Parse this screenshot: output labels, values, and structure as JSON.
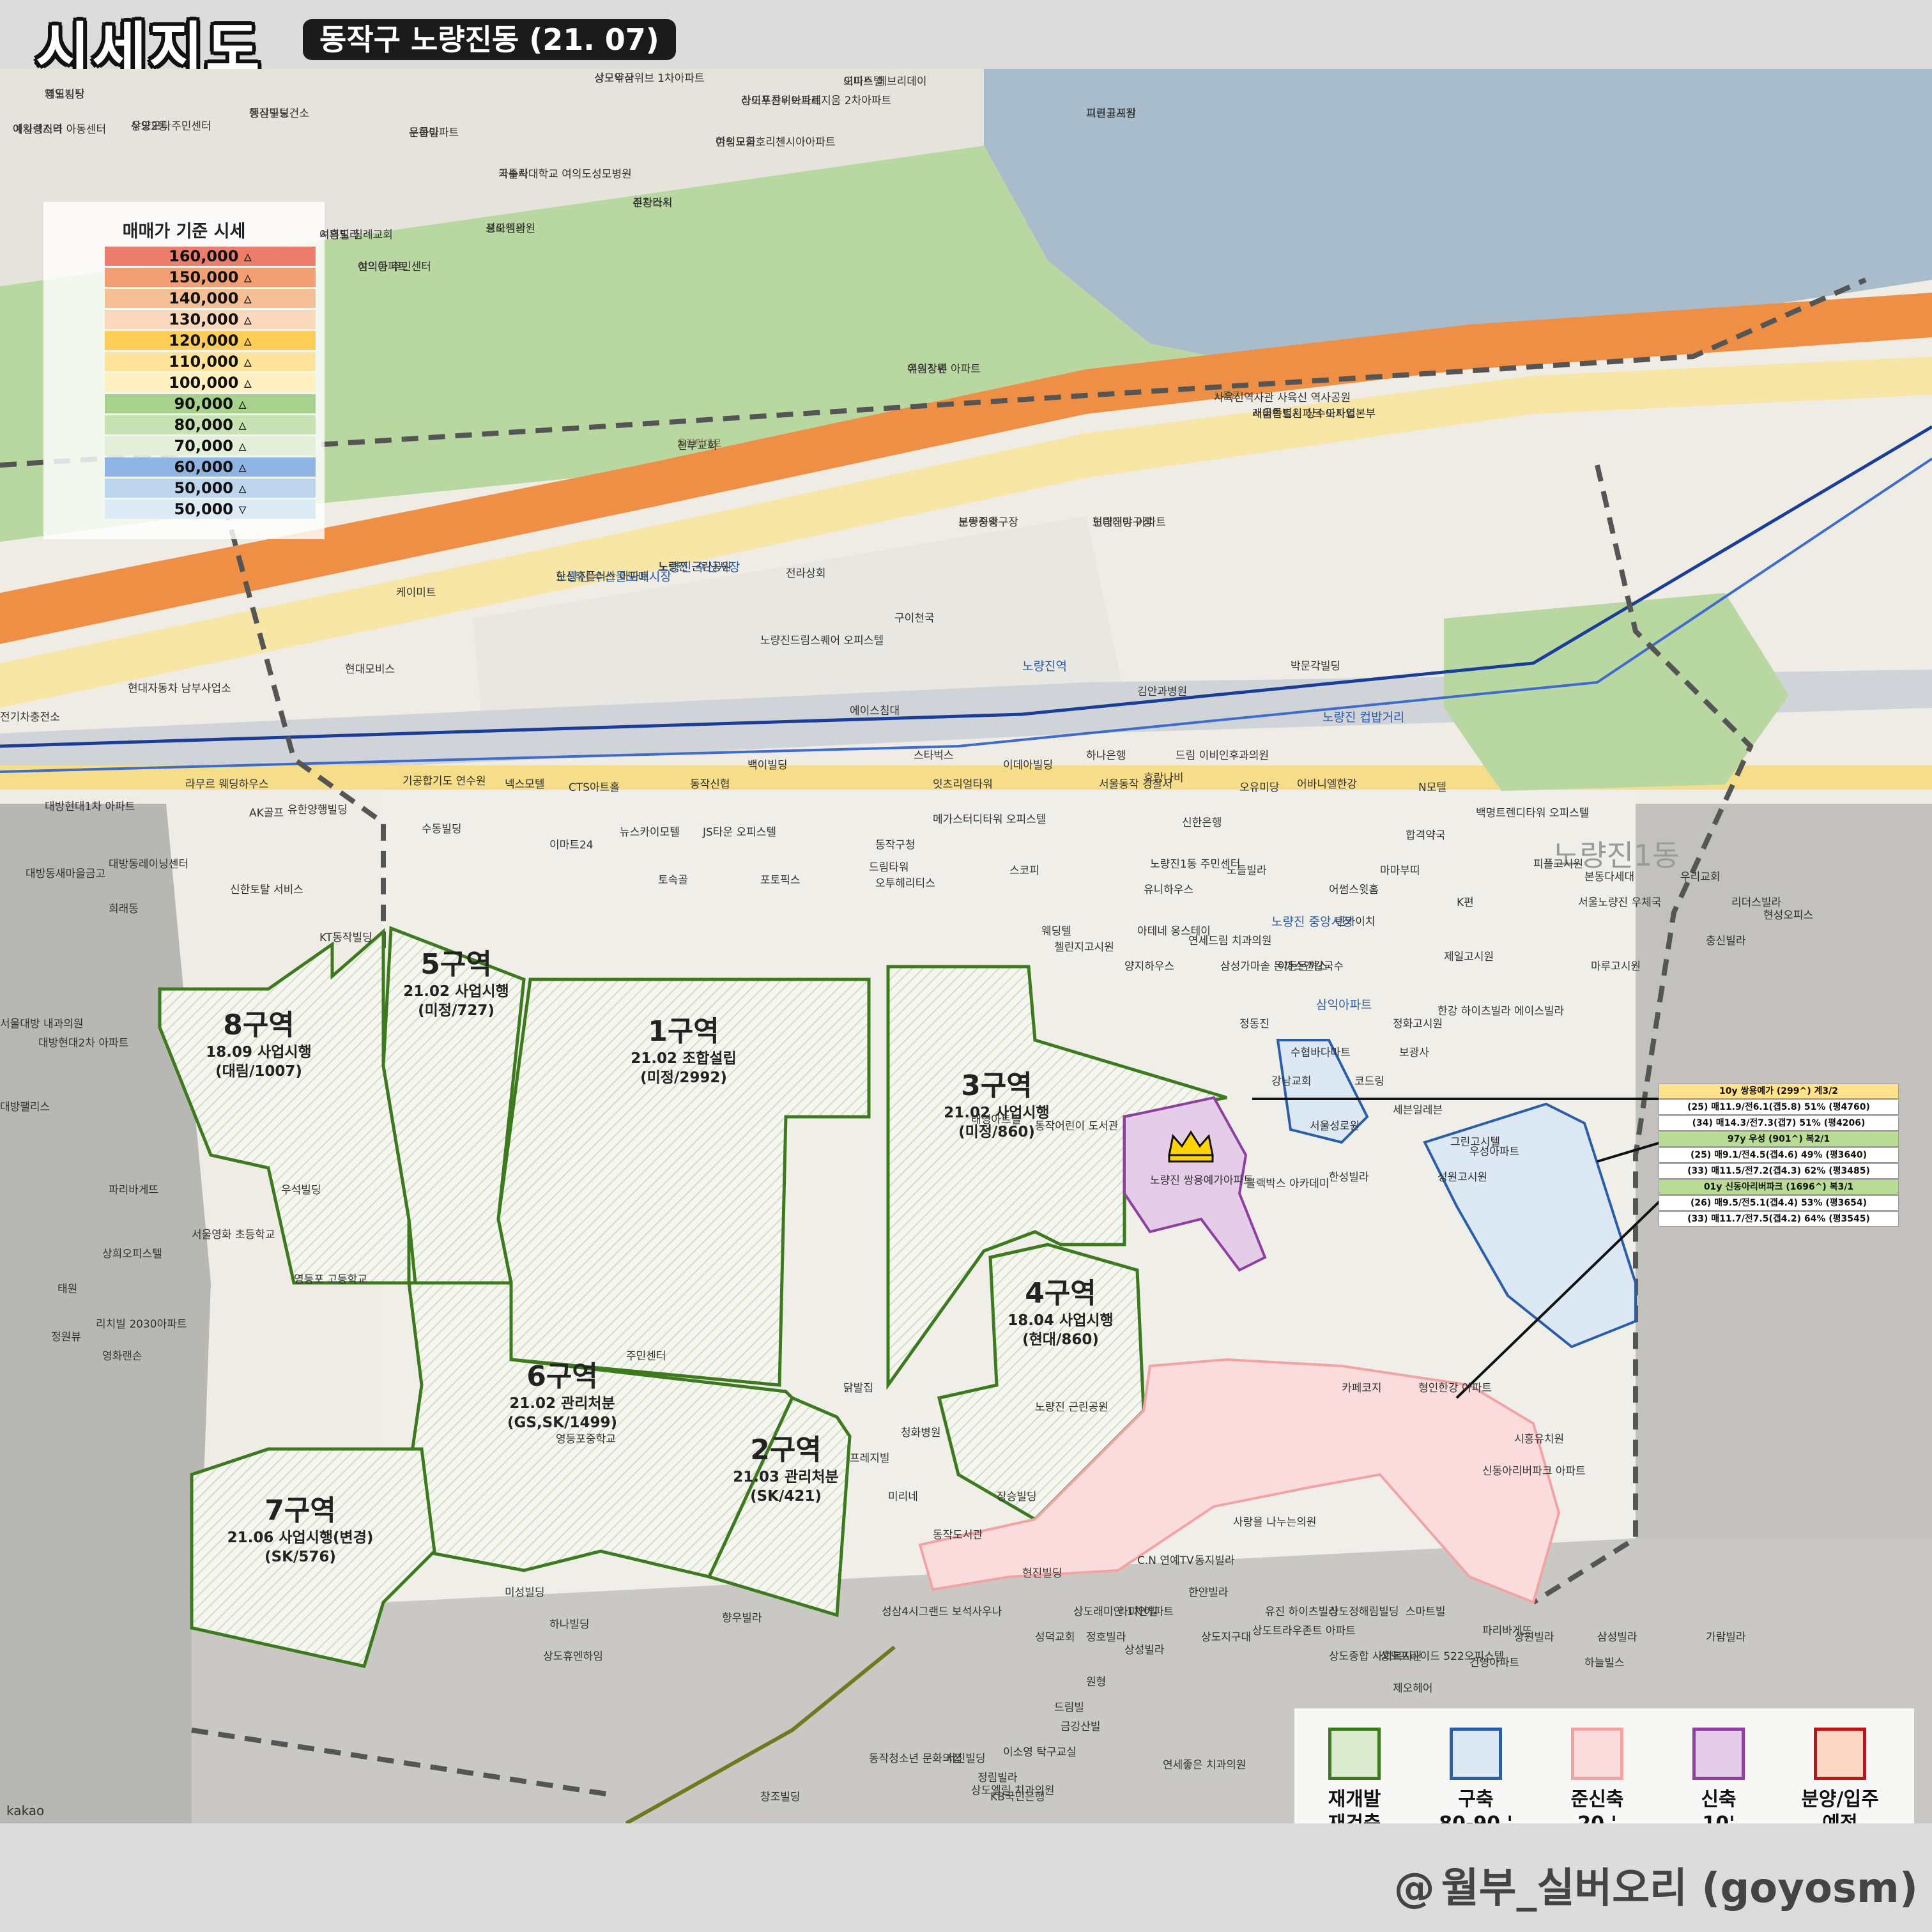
{
  "header": {
    "title": "시세지도",
    "subtitle": "동작구 노량진동 (21. 07)"
  },
  "footer": {
    "credit": "월부_실버오리 (goyosm)",
    "credit_icon": "@"
  },
  "map": {
    "attribution": "kakao",
    "district_label": "노량진1동"
  },
  "price_legend": {
    "title": "매매가 기준 시세",
    "rows": [
      {
        "label": "160,000 ▵",
        "color": "#ec7d6d"
      },
      {
        "label": "150,000 ▵",
        "color": "#f2a073"
      },
      {
        "label": "140,000 ▵",
        "color": "#f6bf95"
      },
      {
        "label": "130,000 ▵",
        "color": "#fad8bd"
      },
      {
        "label": "120,000 ▵",
        "color": "#fecd57"
      },
      {
        "label": "110,000 ▵",
        "color": "#fee49a"
      },
      {
        "label": "100,000 ▵",
        "color": "#fff0c2"
      },
      {
        "label": "90,000 ▵",
        "color": "#a9d18e"
      },
      {
        "label": "80,000 ▵",
        "color": "#c9e2b4"
      },
      {
        "label": "70,000 ▵",
        "color": "#e3efd9"
      },
      {
        "label": "60,000 ▵",
        "color": "#8eb4e3"
      },
      {
        "label": "50,000 ▵",
        "color": "#bdd6ee"
      },
      {
        "label": "50,000 ▿",
        "color": "#ddebf7"
      }
    ]
  },
  "zones": [
    {
      "name": "8구역",
      "stage": "18.09 사업시행",
      "detail": "(대림/1007)"
    },
    {
      "name": "5구역",
      "stage": "21.02 사업시행",
      "detail": "(미정/727)"
    },
    {
      "name": "1구역",
      "stage": "21.02 조합설립",
      "detail": "(미정/2992)"
    },
    {
      "name": "3구역",
      "stage": "21.02 사업시행",
      "detail": "(미정/860)"
    },
    {
      "name": "4구역",
      "stage": "18.04 사업시행",
      "detail": "(현대/860)"
    },
    {
      "name": "6구역",
      "stage": "21.02 관리처분",
      "detail": "(GS,SK/1499)"
    },
    {
      "name": "2구역",
      "stage": "21.03 관리처분",
      "detail": "(SK/421)"
    },
    {
      "name": "7구역",
      "stage": "21.06 사업시행(변경)",
      "detail": "(SK/576)"
    }
  ],
  "info_card": {
    "rows": [
      {
        "text": "10y 쌍용예가 (299^) 계3/2",
        "style": "hd-y"
      },
      {
        "text": "(25) 매11.9/전6.1(갭5.8) 51% (평4760)",
        "style": ""
      },
      {
        "text": "(34) 매14.3/전7.3(갭7) 51% (평4206)",
        "style": ""
      },
      {
        "text": "97y 우성 (901^) 복2/1",
        "style": "hd-g"
      },
      {
        "text": "(25) 매9.1/전4.5(갭4.6) 49% (평3640)",
        "style": ""
      },
      {
        "text": "(33) 매11.5/전7.2(갭4.3) 62% (평3485)",
        "style": ""
      },
      {
        "text": "01y 신동아리버파크 (1696^) 복3/1",
        "style": "hd-g"
      },
      {
        "text": "(26) 매9.5/전5.1(갭4.4) 53% (평3654)",
        "style": ""
      },
      {
        "text": "(33) 매11.7/전7.5(갭4.2) 64% (평3545)",
        "style": ""
      }
    ]
  },
  "type_legend": [
    {
      "label1": "재개발",
      "label2": "재건축",
      "border": "#3d7a1f",
      "fill": "#dcebcf"
    },
    {
      "label1": "구축",
      "label2": "80-90 '",
      "border": "#2a5ea8",
      "fill": "#dde8f5"
    },
    {
      "label1": "준신축",
      "label2": "20 '",
      "border": "#f2a3a3",
      "fill": "#fbdcdc"
    },
    {
      "label1": "신축",
      "label2": "10'",
      "border": "#8e3fa0",
      "fill": "#e5cde9"
    },
    {
      "label1": "분양/입주",
      "label2": "예정",
      "border": "#c0141a",
      "fill": "#fbd8c4"
    }
  ],
  "places": [
    {
      "t": "제일빌딩",
      "c": ""
    },
    {
      "t": "행진빌딩",
      "c": ""
    },
    {
      "t": "아일렉스타",
      "c": ""
    },
    {
      "t": "우양모다",
      "c": ""
    },
    {
      "t": "성모약국",
      "c": ""
    },
    {
      "t": "라이프콤비아파트",
      "c": ""
    },
    {
      "t": "여의도금호리첸시아아파트",
      "c": ""
    },
    {
      "t": "오피스텔",
      "c": ""
    },
    {
      "t": "피크골프장",
      "c": ""
    },
    {
      "t": "은하아파트",
      "c": ""
    },
    {
      "t": "가톨릭대학교 여의도성모병원",
      "c": ""
    },
    {
      "t": "주차타워",
      "c": ""
    },
    {
      "t": "성오센관",
      "c": ""
    },
    {
      "t": "여의도 침례교회",
      "c": ""
    },
    {
      "t": "여의동 주민센터",
      "c": ""
    },
    {
      "t": "올림픽대로",
      "c": "road"
    },
    {
      "t": "여의상류",
      "c": ""
    },
    {
      "t": "노들로",
      "c": "road"
    },
    {
      "t": "서울특별시 상수도사업본부",
      "c": ""
    },
    {
      "t": "노량진축구장",
      "c": ""
    },
    {
      "t": "노량진야구장",
      "c": ""
    },
    {
      "t": "노량진 수산물도매시장",
      "c": "blue"
    },
    {
      "t": "노량진 수산시장",
      "c": "blue"
    },
    {
      "t": "전라상회",
      "c": ""
    },
    {
      "t": "케이미트",
      "c": ""
    },
    {
      "t": "구이천국",
      "c": ""
    },
    {
      "t": "노량진드림스퀘어 오피스텔",
      "c": ""
    },
    {
      "t": "노량진역",
      "c": "blue"
    },
    {
      "t": "현대모비스",
      "c": ""
    },
    {
      "t": "현대자동차 남부사업소",
      "c": ""
    },
    {
      "t": "전기차충전소",
      "c": ""
    },
    {
      "t": "에이스침대",
      "c": ""
    },
    {
      "t": "김안과병원",
      "c": ""
    },
    {
      "t": "박문각빌딩",
      "c": ""
    },
    {
      "t": "노량진 컵밥거리",
      "c": "blue"
    },
    {
      "t": "스타벅스",
      "c": ""
    },
    {
      "t": "백이빌딩",
      "c": ""
    },
    {
      "t": "동작신협",
      "c": ""
    },
    {
      "t": "이데아빌딩",
      "c": ""
    },
    {
      "t": "하나은행",
      "c": ""
    },
    {
      "t": "드림 이비인후과의원",
      "c": ""
    },
    {
      "t": "서울동작 경찰서",
      "c": ""
    },
    {
      "t": "호랑나비",
      "c": ""
    },
    {
      "t": "오유미당",
      "c": ""
    },
    {
      "t": "어바니엘한강",
      "c": ""
    },
    {
      "t": "N모텔",
      "c": ""
    },
    {
      "t": "백명트렌디타워 오피스텔",
      "c": ""
    },
    {
      "t": "기공합기도 연수원",
      "c": ""
    },
    {
      "t": "넥스모텔",
      "c": ""
    },
    {
      "t": "CTS아트홀",
      "c": ""
    },
    {
      "t": "잇츠리얼타워",
      "c": ""
    },
    {
      "t": "메가스터디타워 오피스텔",
      "c": ""
    },
    {
      "t": "신한은행",
      "c": ""
    },
    {
      "t": "합격약국",
      "c": ""
    },
    {
      "t": "라무르 웨딩하우스",
      "c": ""
    },
    {
      "t": "AK골프",
      "c": ""
    },
    {
      "t": "유한양행빌딩",
      "c": ""
    },
    {
      "t": "대방현대1차 아파트",
      "c": ""
    },
    {
      "t": "수동빌딩",
      "c": ""
    },
    {
      "t": "뉴스카이모텔",
      "c": ""
    },
    {
      "t": "이마트24",
      "c": ""
    },
    {
      "t": "JS타운 오피스텔",
      "c": ""
    },
    {
      "t": "동작구청",
      "c": ""
    },
    {
      "t": "드림타워",
      "c": ""
    },
    {
      "t": "오투헤리티스",
      "c": ""
    },
    {
      "t": "스코피",
      "c": ""
    },
    {
      "t": "노량진1동 주민센터",
      "c": ""
    },
    {
      "t": "유니하우스",
      "c": ""
    },
    {
      "t": "노들빌라",
      "c": ""
    },
    {
      "t": "어썸스윗홈",
      "c": ""
    },
    {
      "t": "마마부띠",
      "c": ""
    },
    {
      "t": "K편",
      "c": ""
    },
    {
      "t": "피플고시원",
      "c": ""
    },
    {
      "t": "본동다세대",
      "c": ""
    },
    {
      "t": "서울노량진 우체국",
      "c": ""
    },
    {
      "t": "우리교회",
      "c": ""
    },
    {
      "t": "리더스빌라",
      "c": ""
    },
    {
      "t": "현성오피스",
      "c": ""
    },
    {
      "t": "토속골",
      "c": ""
    },
    {
      "t": "포토픽스",
      "c": ""
    },
    {
      "t": "대방동레이닝센터",
      "c": ""
    },
    {
      "t": "대방동새마을금고",
      "c": ""
    },
    {
      "t": "신한토탈 서비스",
      "c": ""
    },
    {
      "t": "희래동",
      "c": ""
    },
    {
      "t": "KT동작빌딩",
      "c": ""
    },
    {
      "t": "웨딩텔",
      "c": ""
    },
    {
      "t": "첼린지고시원",
      "c": ""
    },
    {
      "t": "아테네 옹스테이",
      "c": ""
    },
    {
      "t": "연세드림 치과의원",
      "c": ""
    },
    {
      "t": "노량진 중앙시장",
      "c": "blue"
    },
    {
      "t": "텐카이치",
      "c": ""
    },
    {
      "t": "제일고시원",
      "c": ""
    },
    {
      "t": "마루고시원",
      "c": ""
    },
    {
      "t": "충신빌라",
      "c": ""
    },
    {
      "t": "양지하우스",
      "c": ""
    },
    {
      "t": "삼성가마솥 돈까스앤칼국수",
      "c": ""
    },
    {
      "t": "이든돈까스",
      "c": ""
    },
    {
      "t": "삼익아파트",
      "c": "blue"
    },
    {
      "t": "정화고시원",
      "c": ""
    },
    {
      "t": "한강 하이츠빌라",
      "c": ""
    },
    {
      "t": "에이스빌라",
      "c": ""
    },
    {
      "t": "서울대방 내과의원",
      "c": ""
    },
    {
      "t": "대방현대2차 아파트",
      "c": ""
    },
    {
      "t": "노량진 쌍용예가아파트",
      "c": ""
    },
    {
      "t": "정동진",
      "c": ""
    },
    {
      "t": "수협바다마트",
      "c": ""
    },
    {
      "t": "보광사",
      "c": ""
    },
    {
      "t": "강남교회",
      "c": ""
    },
    {
      "t": "코드링",
      "c": ""
    },
    {
      "t": "세븐일레븐",
      "c": ""
    },
    {
      "t": "우성아파트",
      "c": ""
    },
    {
      "t": "그린고시텔",
      "c": ""
    },
    {
      "t": "서울성로원",
      "c": ""
    },
    {
      "t": "한성빌라",
      "c": ""
    },
    {
      "t": "성원고시원",
      "c": ""
    },
    {
      "t": "블랙박스 아카데미",
      "c": ""
    },
    {
      "t": "동작어린이 도서관",
      "c": ""
    },
    {
      "t": "태영아트빌",
      "c": ""
    },
    {
      "t": "대방팰리스",
      "c": ""
    },
    {
      "t": "우석빌딩",
      "c": ""
    },
    {
      "t": "파리바게뜨",
      "c": ""
    },
    {
      "t": "서울영화 초등학교",
      "c": ""
    },
    {
      "t": "상희오피스텔",
      "c": ""
    },
    {
      "t": "영등포 고등학교",
      "c": ""
    },
    {
      "t": "태원",
      "c": ""
    },
    {
      "t": "리치빌 2030아파트",
      "c": ""
    },
    {
      "t": "정원뷰",
      "c": ""
    },
    {
      "t": "영화랜손",
      "c": ""
    },
    {
      "t": "영등포중학교",
      "c": ""
    },
    {
      "t": "닭발집",
      "c": ""
    },
    {
      "t": "주민센터",
      "c": ""
    },
    {
      "t": "노량진 근린공원",
      "c": ""
    },
    {
      "t": "신동아리버파크 아파트",
      "c": ""
    },
    {
      "t": "시흥유치원",
      "c": ""
    },
    {
      "t": "형인한강 아파트",
      "c": ""
    },
    {
      "t": "카페코지",
      "c": ""
    },
    {
      "t": "사랑을 나누는의원",
      "c": ""
    },
    {
      "t": "C.N 연예TV",
      "c": ""
    },
    {
      "t": "미리네",
      "c": ""
    },
    {
      "t": "청화병원",
      "c": ""
    },
    {
      "t": "프레지빌",
      "c": ""
    },
    {
      "t": "장승빌딩",
      "c": ""
    },
    {
      "t": "동작도서관",
      "c": ""
    },
    {
      "t": "성삼4시그랜드 보석사우나",
      "c": ""
    },
    {
      "t": "향우빌라",
      "c": ""
    },
    {
      "t": "현진빌딩",
      "c": ""
    },
    {
      "t": "한얀빌라",
      "c": ""
    },
    {
      "t": "스마트빌",
      "c": ""
    },
    {
      "t": "파리바게뜨",
      "c": ""
    },
    {
      "t": "상도프라이드 522오피스텔",
      "c": ""
    },
    {
      "t": "건영아파트",
      "c": ""
    },
    {
      "t": "상원빌라",
      "c": ""
    },
    {
      "t": "삼성빌라",
      "c": ""
    },
    {
      "t": "하늘빌스",
      "c": ""
    },
    {
      "t": "가람빌라",
      "c": ""
    },
    {
      "t": "정호빌라",
      "c": ""
    },
    {
      "t": "상도트라우존트 아파트",
      "c": ""
    },
    {
      "t": "상도정해림빌딩",
      "c": ""
    },
    {
      "t": "유진 하이츠빌라",
      "c": ""
    },
    {
      "t": "상성빌라",
      "c": ""
    },
    {
      "t": "상도지구대",
      "c": ""
    },
    {
      "t": "상도종합 사회복지관",
      "c": ""
    },
    {
      "t": "제오헤어",
      "c": ""
    },
    {
      "t": "성덕교회",
      "c": ""
    },
    {
      "t": "상도래미안 1차아파트",
      "c": ""
    },
    {
      "t": "동지빌라",
      "c": ""
    },
    {
      "t": "라미안빌",
      "c": ""
    },
    {
      "t": "미성빌딩",
      "c": ""
    },
    {
      "t": "하나빌딩",
      "c": ""
    },
    {
      "t": "상도휴엔하임",
      "c": ""
    },
    {
      "t": "원형",
      "c": ""
    },
    {
      "t": "드림빌",
      "c": ""
    },
    {
      "t": "금강산빌",
      "c": ""
    },
    {
      "t": "이소영 탁구교실",
      "c": ""
    },
    {
      "t": "서진빌딩",
      "c": ""
    },
    {
      "t": "동작청소년 문화의집",
      "c": ""
    },
    {
      "t": "정림빌라",
      "c": ""
    },
    {
      "t": "연세좋은 치과의원",
      "c": ""
    },
    {
      "t": "KB국민은행",
      "c": ""
    },
    {
      "t": "상도엘림 치과의원",
      "c": ""
    },
    {
      "t": "창조빌딩",
      "c": ""
    },
    {
      "t": "영도시장",
      "c": ""
    },
    {
      "t": "동작구보건소",
      "c": ""
    },
    {
      "t": "예사랑지역 아동센터",
      "c": ""
    },
    {
      "t": "상도2동 주민센터",
      "c": ""
    },
    {
      "t": "상도두산위브 1차아파트",
      "c": ""
    },
    {
      "t": "상도두산위브트레지움 2차아파트",
      "c": ""
    },
    {
      "t": "한성교회",
      "c": ""
    },
    {
      "t": "이마트 에브리데이",
      "c": ""
    },
    {
      "t": "그린고시원",
      "c": ""
    },
    {
      "t": "두롭빌",
      "c": ""
    },
    {
      "t": "국수사",
      "c": ""
    },
    {
      "t": "신광스시",
      "c": ""
    },
    {
      "t": "프라임의원",
      "c": ""
    },
    {
      "t": "시흥빌라",
      "c": ""
    },
    {
      "t": "삼익아파트",
      "c": ""
    },
    {
      "t": "천부교회",
      "c": ""
    },
    {
      "t": "유원강변 아파트",
      "c": ""
    },
    {
      "t": "사육신역사관 사육신 역사공원",
      "c": ""
    },
    {
      "t": "래미안트윈파크 아파트",
      "c": ""
    },
    {
      "t": "본동중앙",
      "c": ""
    },
    {
      "t": "현대대방 아파트",
      "c": ""
    },
    {
      "t": "한신휴플러스 아파트",
      "c": ""
    },
    {
      "t": "노량진 근린공원",
      "c": ""
    }
  ]
}
